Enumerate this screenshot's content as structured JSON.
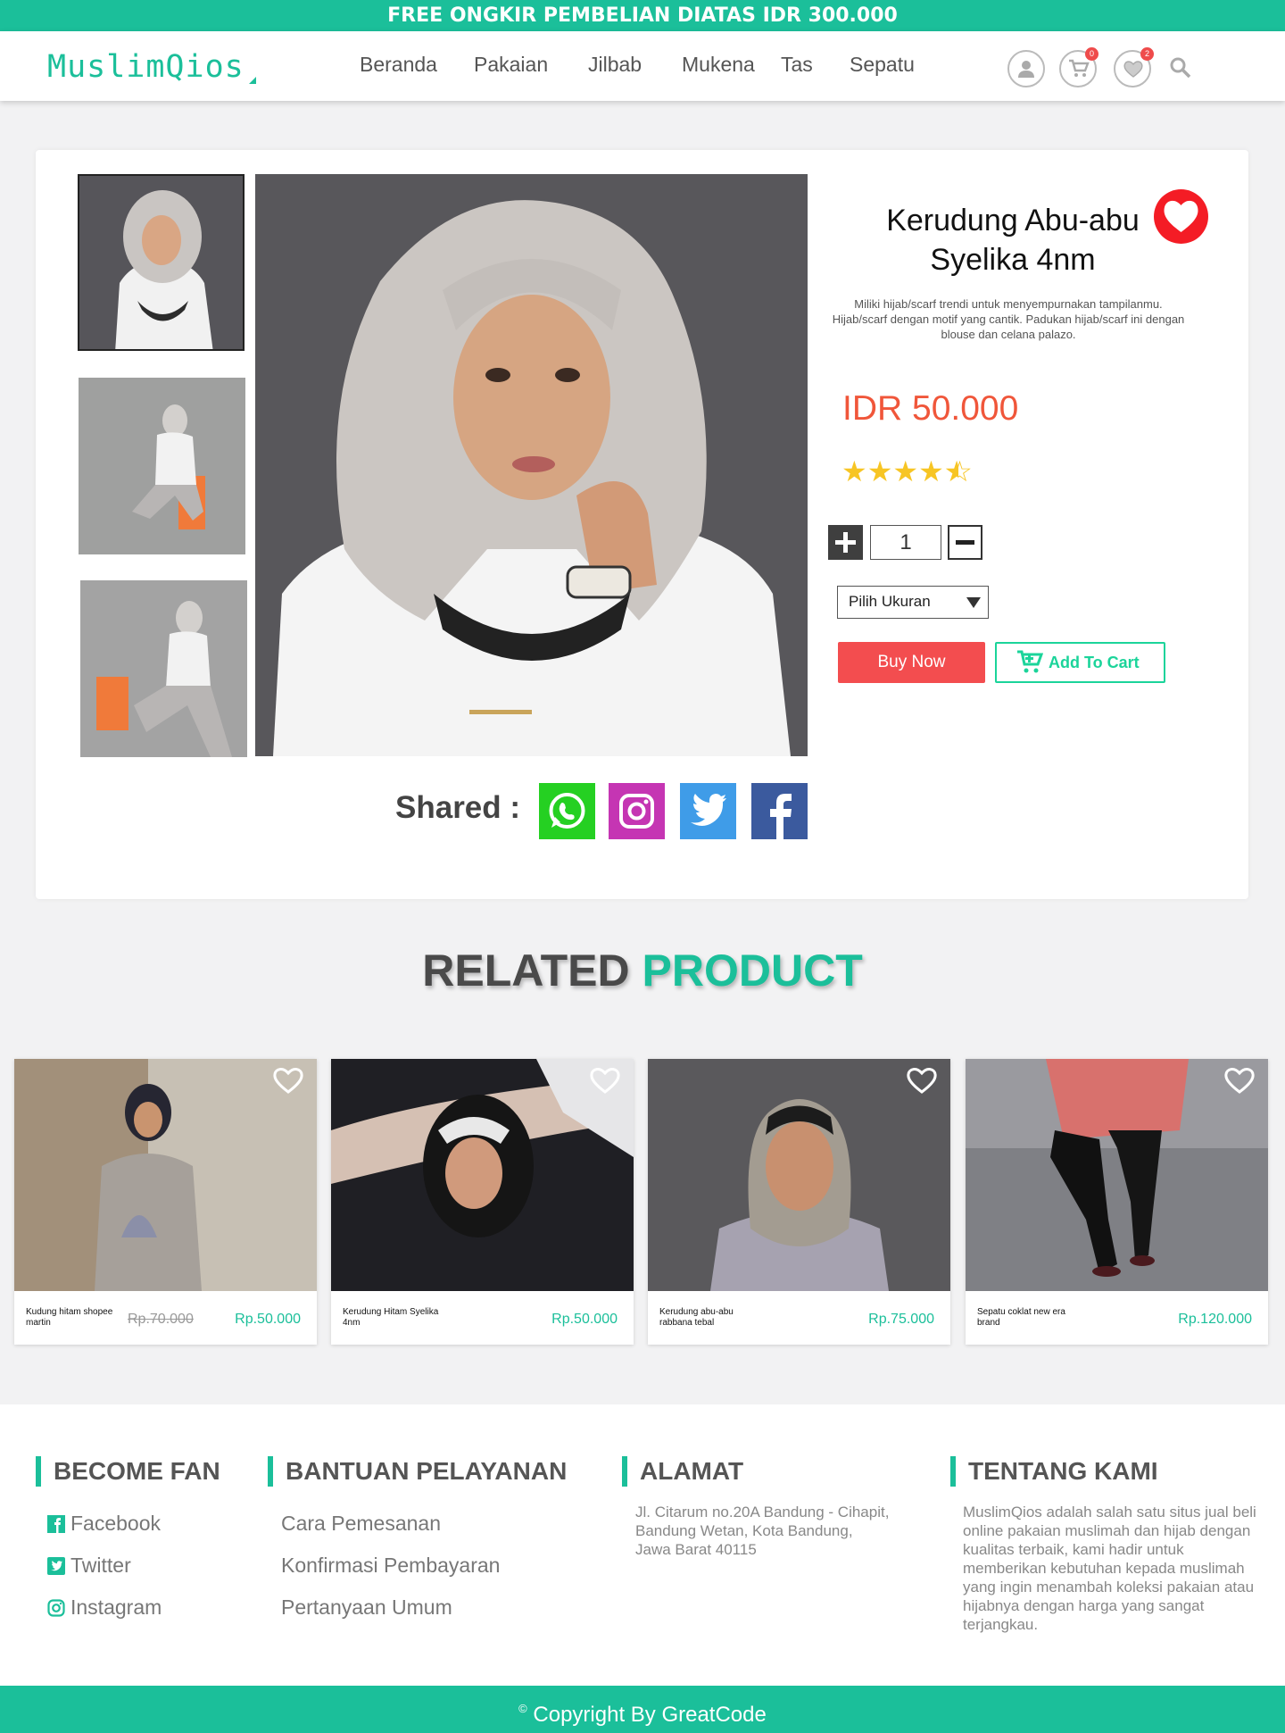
{
  "promo": {
    "text": "FREE ONGKIR PEMBELIAN DIATAS IDR 300.000"
  },
  "header": {
    "logo": "MuslimQios",
    "nav": [
      "Beranda",
      "Pakaian",
      "Jilbab",
      "Mukena",
      "Tas",
      "Sepatu"
    ],
    "cart_count": "0",
    "wishlist_count": "2",
    "icons": [
      "user-icon",
      "cart-icon",
      "heart-icon",
      "search-icon"
    ]
  },
  "product": {
    "title_line1": "Kerudung Abu-abu",
    "title_line2": "Syelika 4nm",
    "description": "Miliki hijab/scarf trendi untuk menyempurnakan tampilanmu. Hijab/scarf dengan motif yang cantik. Padukan hijab/scarf ini dengan blouse dan celana palazo.",
    "price": "IDR 50.000",
    "rating": 4.5,
    "quantity": "1",
    "size_select": "Pilih Ukuran",
    "buy_label": "Buy Now",
    "cart_label": "Add To Cart",
    "shared_label": "Shared :"
  },
  "related": {
    "title_a": "RELATED",
    "title_b": "PRODUCT",
    "items": [
      {
        "name": "Kudung hitam shopee martin",
        "old_price": "Rp.70.000",
        "price": "Rp.50.000"
      },
      {
        "name": "Kerudung Hitam Syelika 4nm",
        "old_price": "",
        "price": "Rp.50.000"
      },
      {
        "name": "Kerudung abu-abu rabbana tebal",
        "old_price": "",
        "price": "Rp.75.000"
      },
      {
        "name": "Sepatu coklat new era brand",
        "old_price": "",
        "price": "Rp.120.000"
      }
    ]
  },
  "footer": {
    "fan_title": "BECOME FAN",
    "fan_links": [
      "Facebook",
      "Twitter",
      "Instagram"
    ],
    "help_title": "BANTUAN PELAYANAN",
    "help_links": [
      "Cara Pemesanan",
      "Konfirmasi Pembayaran",
      "Pertanyaan Umum"
    ],
    "address_title": "ALAMAT",
    "address": [
      "Jl. Citarum no.20A Bandung - Cihapit,",
      "Bandung Wetan, Kota Bandung,",
      "Jawa Barat 40115"
    ],
    "about_title": "TENTANG KAMI",
    "about": "MuslimQios adalah salah satu situs jual beli online pakaian muslimah dan hijab dengan kualitas terbaik, kami hadir untuk memberikan kebutuhan kepada muslimah yang ingin menambah koleksi pakaian atau hijabnya dengan harga yang sangat terjangkau.",
    "copyright": "Copyright By GreatCode"
  },
  "colors": {
    "accent": "#1bbf9a",
    "price": "#f0563a",
    "buy": "#f34d4f",
    "star": "#f7c524"
  }
}
